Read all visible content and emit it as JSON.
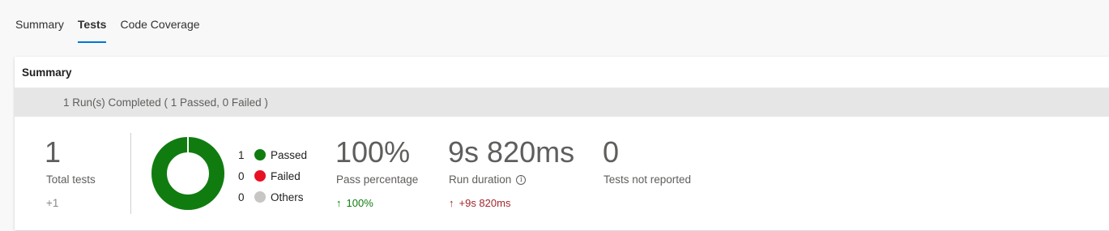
{
  "tabs": [
    {
      "label": "Summary",
      "active": false
    },
    {
      "label": "Tests",
      "active": true
    },
    {
      "label": "Code Coverage",
      "active": false
    }
  ],
  "summary": {
    "title": "Summary",
    "run_status": "1 Run(s) Completed ( 1 Passed, 0 Failed )"
  },
  "total_tests": {
    "value": "1",
    "label": "Total tests",
    "delta": "+1"
  },
  "legend": [
    {
      "count": "1",
      "label": "Passed",
      "color": "#107c10"
    },
    {
      "count": "0",
      "label": "Failed",
      "color": "#e81123"
    },
    {
      "count": "0",
      "label": "Others",
      "color": "#c8c6c4"
    }
  ],
  "donut": {
    "passed_fraction": 1.0,
    "color": "#107c10"
  },
  "pass_percentage": {
    "value": "100%",
    "label": "Pass percentage",
    "delta": "100%",
    "delta_icon": "arrow-up-icon",
    "delta_color": "#107c10"
  },
  "run_duration": {
    "value": "9s 820ms",
    "label": "Run duration",
    "delta": "+9s 820ms",
    "delta_icon": "arrow-up-icon",
    "delta_color": "#a4262c",
    "info_icon": "info-icon"
  },
  "not_reported": {
    "value": "0",
    "label": "Tests not reported"
  }
}
